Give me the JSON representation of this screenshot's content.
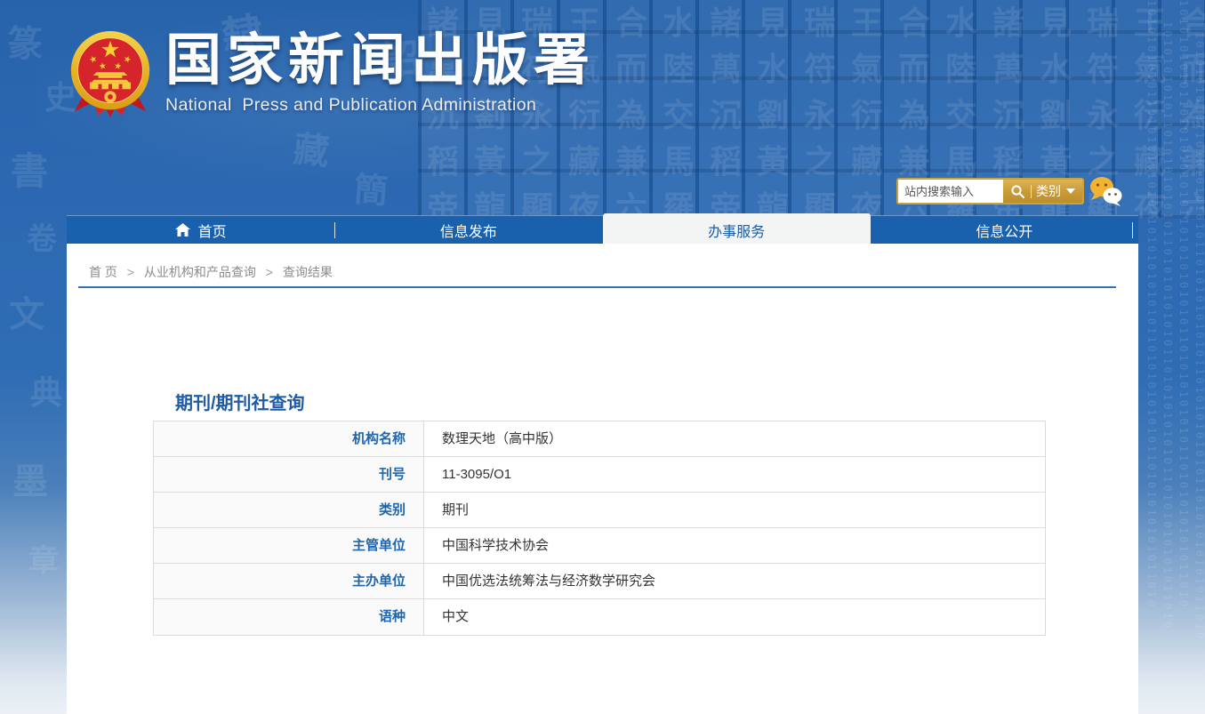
{
  "header": {
    "title": "国家新闻出版署",
    "subtitle": "National  Press and Publication Administration"
  },
  "search": {
    "placeholder": "站内搜索输入",
    "category_label": "类别"
  },
  "nav": {
    "items": [
      {
        "label": "首页"
      },
      {
        "label": "信息发布"
      },
      {
        "label": "办事服务",
        "active": true
      },
      {
        "label": "信息公开"
      }
    ]
  },
  "breadcrumb": {
    "separator": ">",
    "items": [
      "首 页",
      "从业机构和产品查询",
      "查询结果"
    ]
  },
  "main": {
    "title": "期刊/期刊社查询",
    "table": {
      "rows": [
        {
          "label": "机构名称",
          "value": "数理天地（高中版）"
        },
        {
          "label": "刊号",
          "value": "11-3095/O1"
        },
        {
          "label": "类别",
          "value": "期刊"
        },
        {
          "label": "主管单位",
          "value": "中国科学技术协会"
        },
        {
          "label": "主办单位",
          "value": "中国优选法统筹法与经济数学研究会"
        },
        {
          "label": "语种",
          "value": "中文"
        }
      ]
    }
  },
  "colors": {
    "header_blue": "#2c69b2",
    "nav_blue": "#1961ac",
    "active_tab_bg": "#f3f4f4",
    "accent_blue": "#1e5ca8",
    "table_label_blue": "#2166ac",
    "gold": "#c89a36",
    "emblem_red": "#d6242c",
    "emblem_gold": "#f0c040"
  },
  "decor": {
    "binary_column": "1010101010110101010101011010101010101101010101010110101010101011010",
    "tile_rows": [
      "諸見瑞王合水諸見瑞王合水諸見瑞王合水",
      "萬水符氣而陸萬水符氣而陸萬水符氣而陸",
      "沉劉永衍為交沉劉永衍為交沉劉永衍為交",
      "稻黃之藏兼馬稻黃之藏兼馬稻黃之藏兼馬",
      "帝龍顯夜六羅帝龍顯夜六羅帝龍顯夜六羅"
    ],
    "seal_glyphs": [
      "篆",
      "史",
      "書",
      "卷",
      "文",
      "典",
      "墨",
      "章",
      "隸",
      "藏",
      "詔",
      "簡"
    ]
  }
}
